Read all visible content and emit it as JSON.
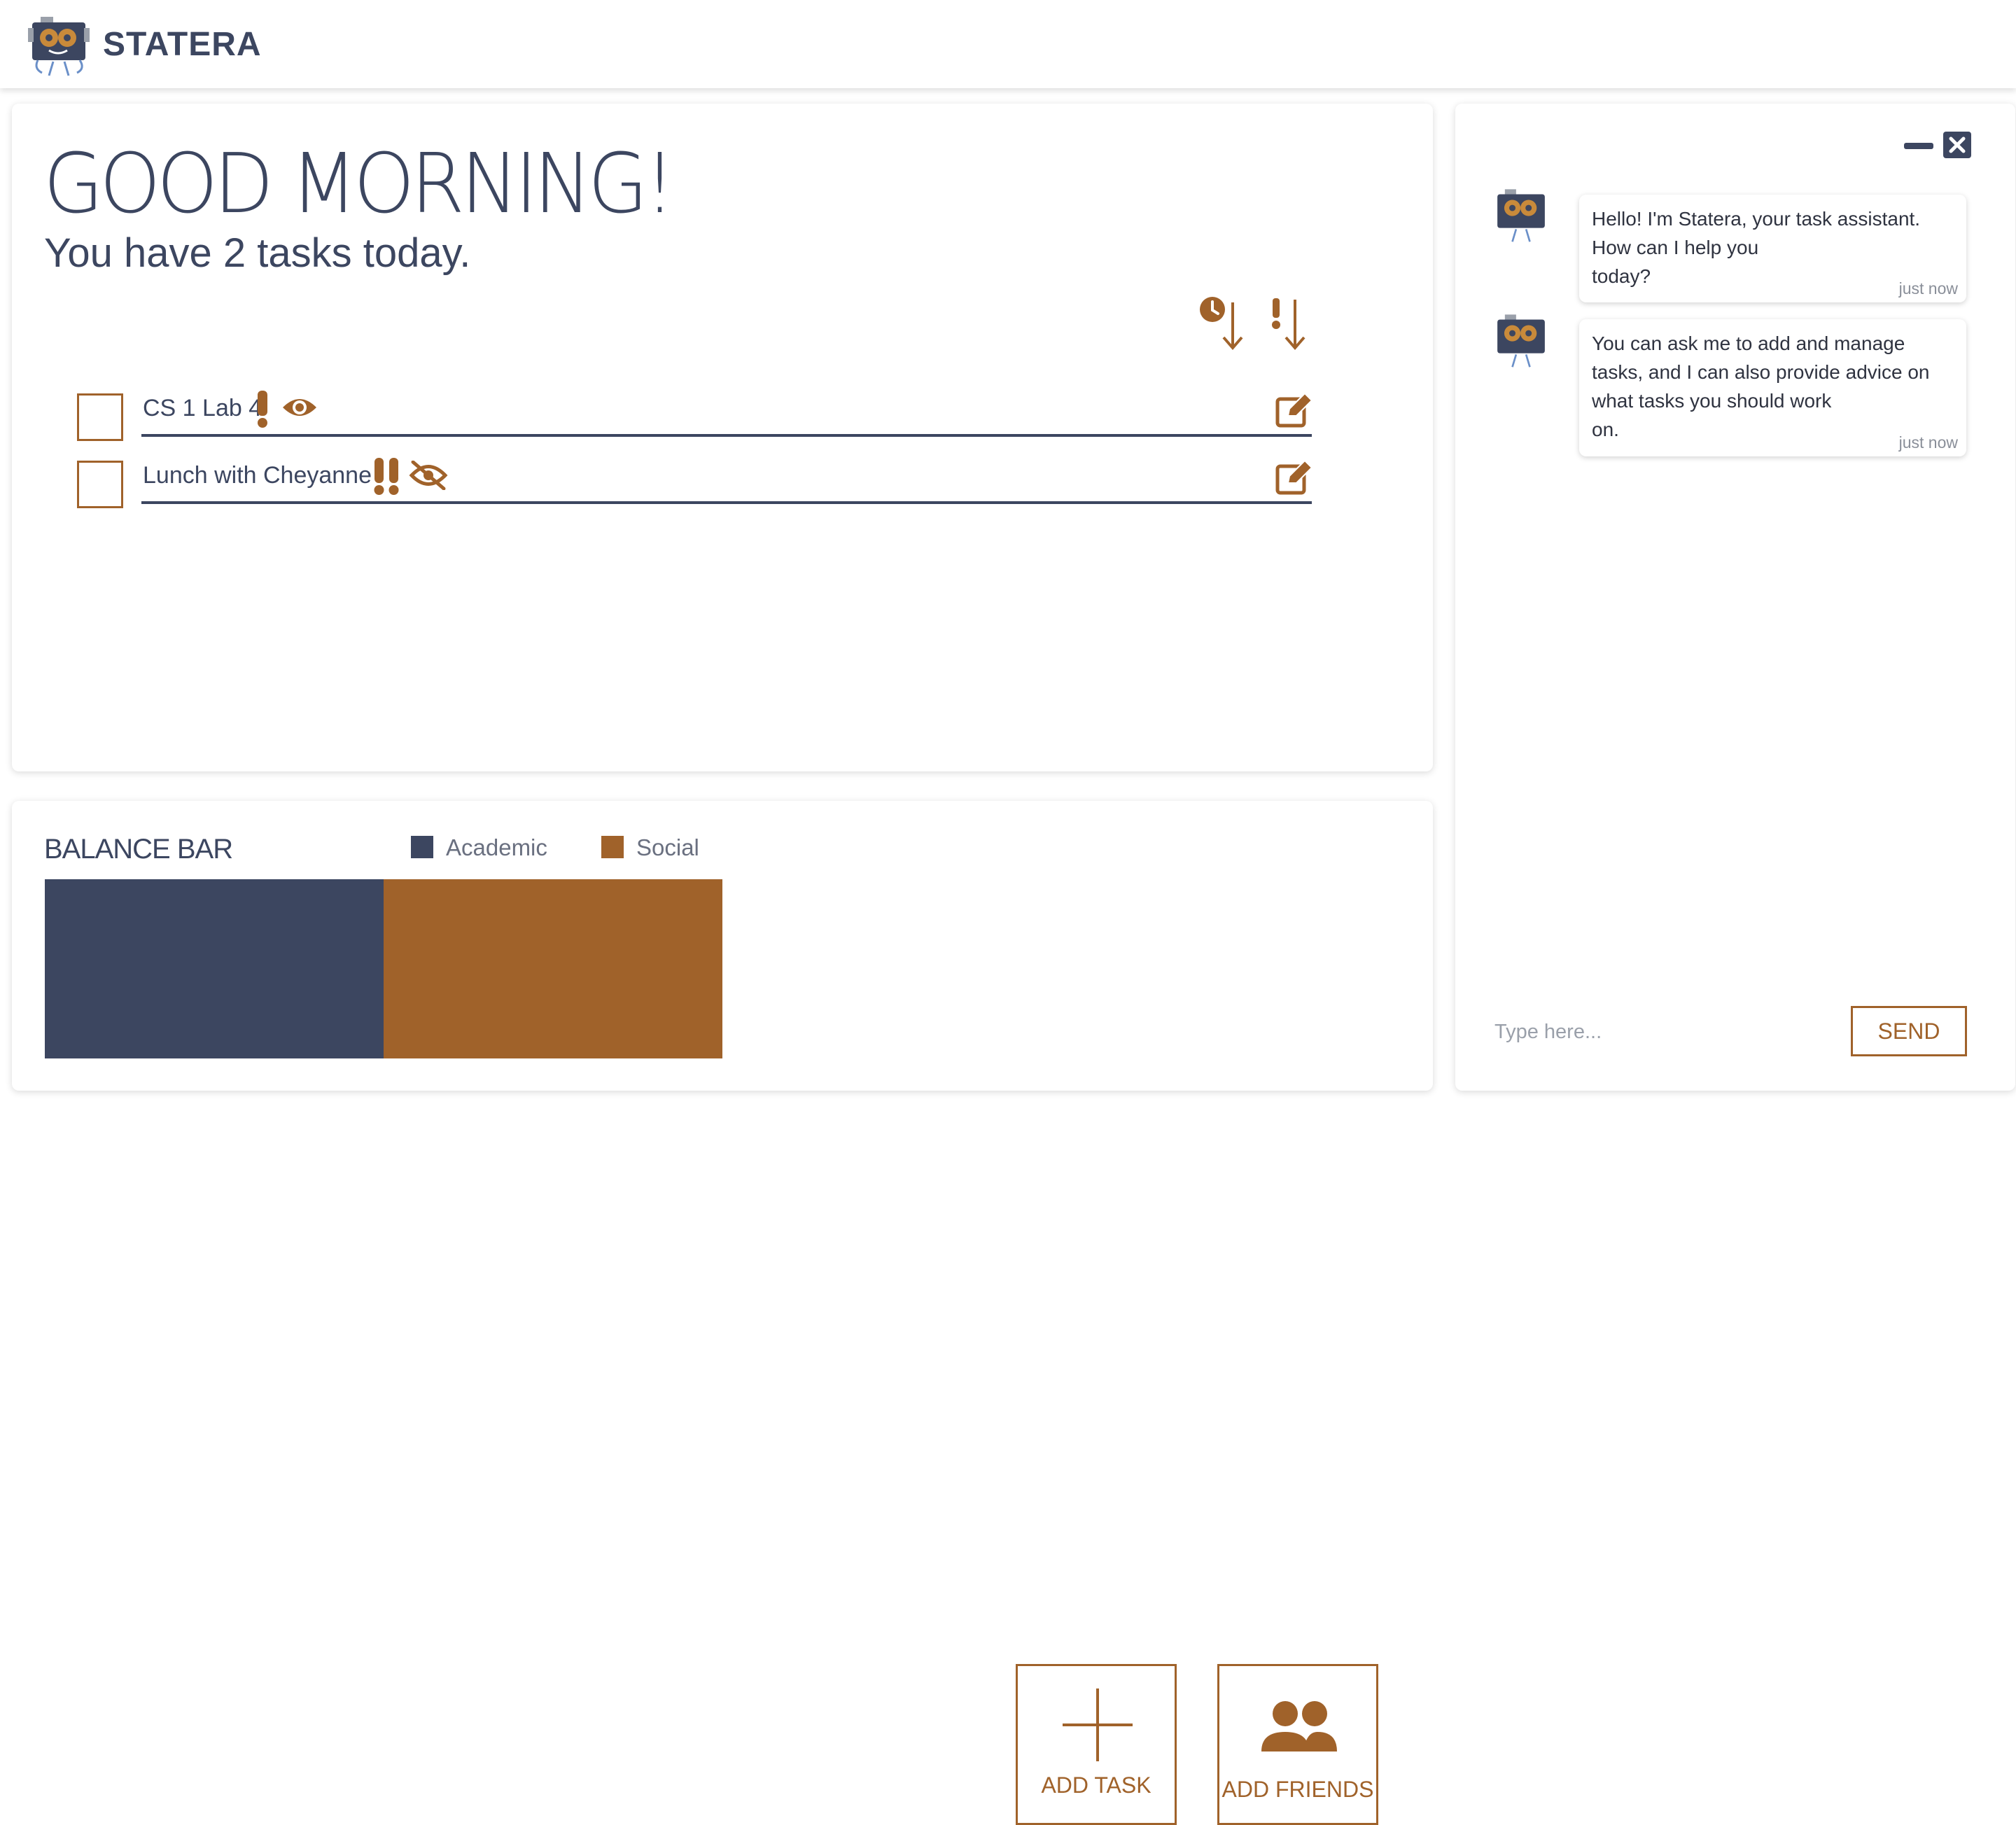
{
  "brand": {
    "name": "STATERA",
    "logo_icon": "robot-logo-icon"
  },
  "greeting": {
    "title": "GOOD MORNING!",
    "subtitle": "You have 2 tasks today."
  },
  "sort": {
    "time_icon": "clock-sort-down-icon",
    "priority_icon": "priority-sort-down-icon"
  },
  "tasks": [
    {
      "label": "CS 1 Lab 4",
      "priority_icon": "exclamation-icon",
      "visibility_icon": "eye-icon",
      "checked": false
    },
    {
      "label": "Lunch with Cheyanne",
      "priority_icon": "double-exclamation-icon",
      "visibility_icon": "eye-slash-icon",
      "checked": false
    }
  ],
  "balance": {
    "title": "BALANCE BAR",
    "legend": [
      {
        "label": "Academic",
        "color": "#3c4660"
      },
      {
        "label": "Social",
        "color": "#a0622a"
      }
    ],
    "shares": {
      "academic": 0.5,
      "social": 0.5
    }
  },
  "actions": {
    "add_task": "ADD TASK",
    "add_friends": "ADD FRIENDS"
  },
  "chat": {
    "messages": [
      {
        "lines": [
          "Hello! I'm Statera, your task assistant.",
          "How can I help you",
          "today?"
        ],
        "time": "just now"
      },
      {
        "lines": [
          "You can ask me to add and manage",
          "tasks, and I can also provide advice on",
          "what tasks you should work",
          "on."
        ],
        "time": "just now"
      }
    ],
    "input_placeholder": "Type here...",
    "send_label": "SEND"
  },
  "colors": {
    "primary": "#3c4660",
    "accent": "#a0622a"
  }
}
